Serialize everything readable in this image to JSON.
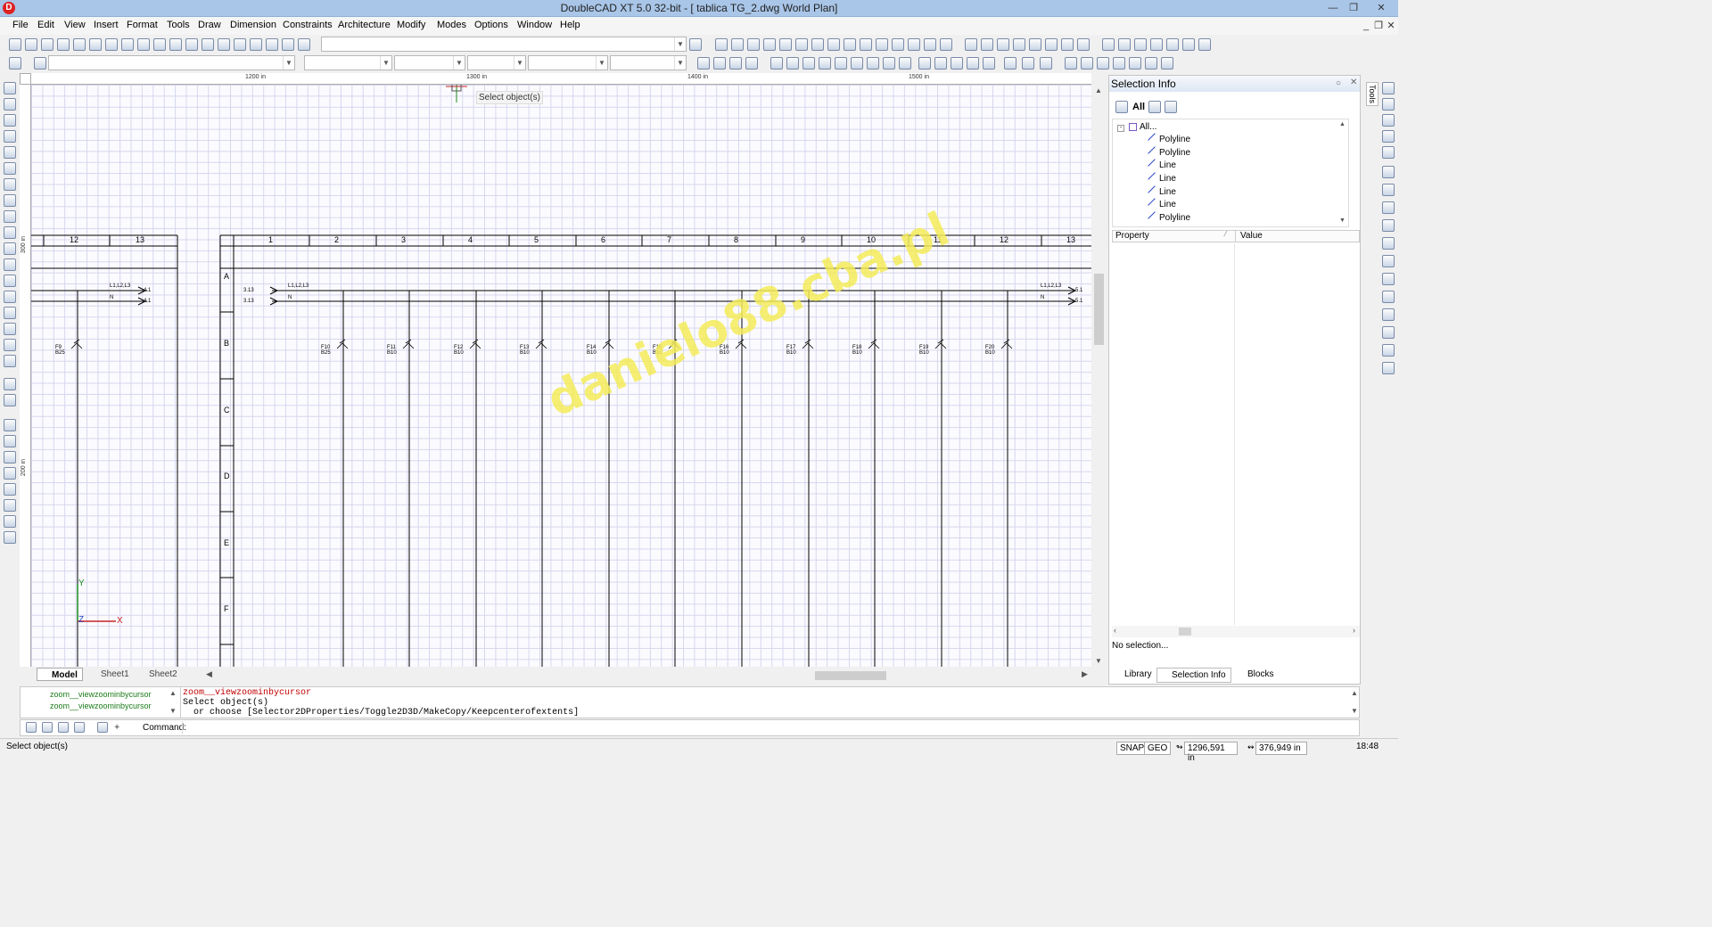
{
  "window": {
    "title": "DoubleCAD XT 5.0 32-bit - [ tablica TG_2.dwg World Plan]",
    "app_icon": "D"
  },
  "menu": [
    "File",
    "Edit",
    "View",
    "Insert",
    "Format",
    "Tools",
    "Draw",
    "Dimension",
    "Constraints",
    "Architecture",
    "Modify",
    "Modes",
    "Options",
    "Window",
    "Help"
  ],
  "ruler": {
    "h": [
      "1200 in",
      "1300 in",
      "1400 in",
      "1500 in"
    ],
    "v": [
      "300 in",
      "200 in"
    ]
  },
  "tooltip": "Select object(s)",
  "drawing": {
    "left_cols": [
      "12",
      "13"
    ],
    "cols": [
      "1",
      "2",
      "3",
      "4",
      "5",
      "6",
      "7",
      "8",
      "9",
      "10",
      "11",
      "12",
      "13"
    ],
    "rows": [
      "A",
      "B",
      "C",
      "D",
      "E",
      "F"
    ],
    "bus_label": "L1,L2,L3",
    "n_label": "N",
    "sheet_ref_1": "3.13",
    "sheet_ref_2": "5.1",
    "left_ref": "4.1",
    "breakers": [
      {
        "f": "F9",
        "b": "B25"
      },
      {
        "f": "F10",
        "b": "B25"
      },
      {
        "f": "F11",
        "b": "B10"
      },
      {
        "f": "F12",
        "b": "B10"
      },
      {
        "f": "F13",
        "b": "B10"
      },
      {
        "f": "F14",
        "b": "B10"
      },
      {
        "f": "F15",
        "b": "B10"
      },
      {
        "f": "F16",
        "b": "B10"
      },
      {
        "f": "F17",
        "b": "B10"
      },
      {
        "f": "F18",
        "b": "B10"
      },
      {
        "f": "F19",
        "b": "B10"
      },
      {
        "f": "F20",
        "b": "B10"
      }
    ],
    "watermark": "danielo88.cba.pl",
    "axis": {
      "y": "Y",
      "x": "X",
      "z": "Z"
    }
  },
  "layout_tabs": [
    "Model",
    "Sheet1",
    "Sheet2"
  ],
  "panel": {
    "title": "Selection Info",
    "filter_all": "All",
    "tree_root": "All...",
    "items": [
      "Polyline",
      "Polyline",
      "Line",
      "Line",
      "Line",
      "Line",
      "Polyline"
    ],
    "col_property": "Property",
    "col_value": "Value",
    "status": "No selection...",
    "bottom_tabs": [
      "Library",
      "Selection Info",
      "Blocks"
    ],
    "side_tab": "Tools"
  },
  "command": {
    "history": [
      "zoom__viewzoominbycursor",
      "zoom__viewzoominbycursor"
    ],
    "line1": "zoom__viewzoominbycursor",
    "line2": "Select object(s)",
    "line3": "  or choose [Selector2DProperties/Toggle2D3D/MakeCopy/Keepcenterofextents]",
    "prompt": "Command:"
  },
  "status": {
    "text": "Select object(s)",
    "snap": "SNAP",
    "geo": "GEO",
    "x": "1296,591 in",
    "y": "376,949 in",
    "time": "18:48"
  },
  "colors": {
    "title_bg": "#a9c6e8",
    "grid": "#d6d6ee",
    "watermark": "#f4ec5a",
    "axis_y": "#1a8a1a",
    "axis_x": "#c82424",
    "command_red": "#c00000",
    "history_green": "#1a7a1a"
  }
}
